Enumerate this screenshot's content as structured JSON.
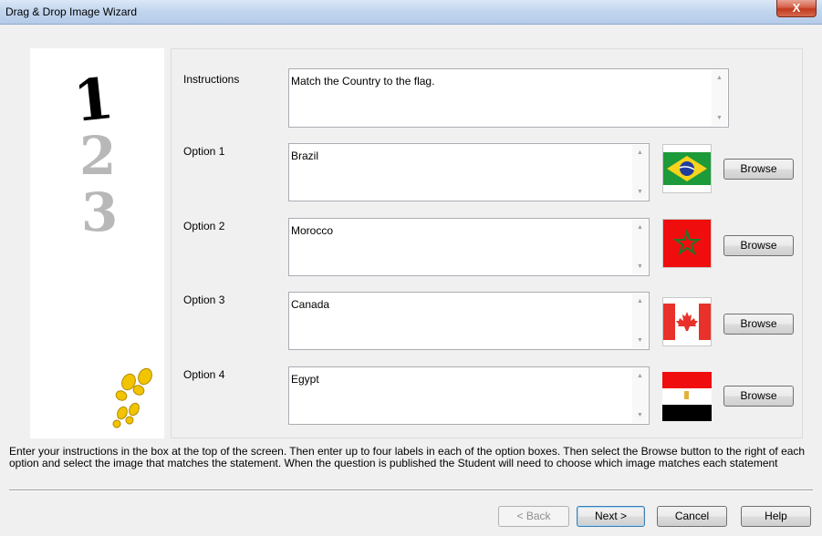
{
  "window": {
    "title": "Drag & Drop Image Wizard",
    "close_label": "X"
  },
  "left_panel": {
    "digits": [
      "1",
      "2",
      "3"
    ]
  },
  "instructions": {
    "label": "Instructions",
    "value": "Match the Country to the flag."
  },
  "options": [
    {
      "label": "Option 1",
      "value": "Brazil",
      "flag": "brazil-flag",
      "browse_label": "Browse"
    },
    {
      "label": "Option 2",
      "value": "Morocco",
      "flag": "morocco-flag",
      "browse_label": "Browse"
    },
    {
      "label": "Option 3",
      "value": "Canada",
      "flag": "canada-flag",
      "browse_label": "Browse"
    },
    {
      "label": "Option 4",
      "value": "Egypt",
      "flag": "egypt-flag",
      "browse_label": "Browse"
    }
  ],
  "help_text": "Enter your instructions in the box at the top of the screen. Then enter up to four labels in each of the option boxes. Then select the Browse button to the right of each option and select the image that matches the statement. When the question is published the Student will need to choose which image matches each statement",
  "footer": {
    "back_label": "< Back",
    "next_label": "Next >",
    "cancel_label": "Cancel",
    "help_label": "Help"
  },
  "colors": {
    "titlebar": "#c3d6ee",
    "close": "#c2391e",
    "default_button_border": "#3c7fb1"
  }
}
